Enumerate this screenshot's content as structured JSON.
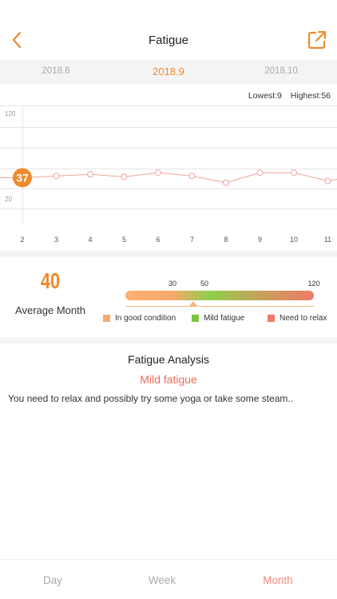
{
  "header": {
    "title": "Fatigue"
  },
  "months": {
    "prev": "2018.8",
    "current": "2018.9",
    "next": "2018.10"
  },
  "range": {
    "lowest": "Lowest:9",
    "highest": "Highest:56"
  },
  "chart_data": {
    "type": "line",
    "x": [
      2,
      3,
      4,
      5,
      6,
      7,
      8,
      9,
      10,
      11
    ],
    "series": [
      {
        "values": [
          37,
          39,
          41,
          38,
          43,
          39,
          31,
          43,
          43,
          33
        ]
      }
    ],
    "y_tick_labels": [
      "120",
      "20"
    ],
    "x_tick_labels": [
      "2",
      "3",
      "4",
      "5",
      "6",
      "7",
      "8",
      "9",
      "10",
      "11"
    ],
    "selected_label": "37",
    "ylim": [
      0,
      120
    ],
    "grid": true
  },
  "summary": {
    "value": "40",
    "label": "Average Month",
    "scale_marks": [
      "30",
      "50",
      "120"
    ],
    "scale_level": 40
  },
  "legend": [
    {
      "label": "In good condition",
      "color": "#f7a96d"
    },
    {
      "label": "Mild fatigue",
      "color": "#7cc343"
    },
    {
      "label": "Need to relax",
      "color": "#ee7a6a"
    }
  ],
  "analysis": {
    "title": "Fatigue Analysis",
    "status": "Mild fatigue",
    "text": "You need to relax and possibly try some yoga or take some steam.."
  },
  "tabs": [
    {
      "label": "Day"
    },
    {
      "label": "Week"
    },
    {
      "label": "Month"
    }
  ],
  "colors": {
    "accent": "#f08a2a",
    "line": "#f3a39a",
    "status": "#ef6b5a"
  },
  "icons": {
    "back": "chevron-left-icon",
    "share": "share-icon"
  }
}
